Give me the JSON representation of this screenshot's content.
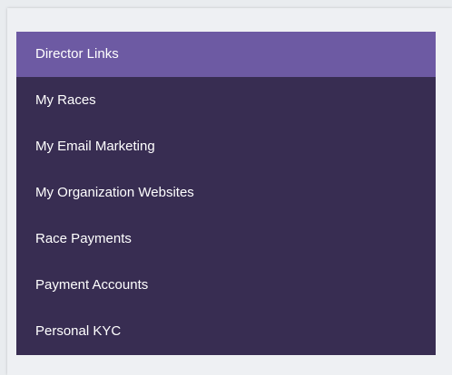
{
  "menu": {
    "header": "Director Links",
    "items": [
      {
        "label": "My Races"
      },
      {
        "label": "My Email Marketing"
      },
      {
        "label": "My Organization Websites"
      },
      {
        "label": "Race Payments"
      },
      {
        "label": "Payment Accounts"
      },
      {
        "label": "Personal KYC"
      }
    ]
  },
  "colors": {
    "page_background": "#e9ecef",
    "header_background": "#6d5aa3",
    "menu_background": "#382d52",
    "text": "#ffffff"
  }
}
